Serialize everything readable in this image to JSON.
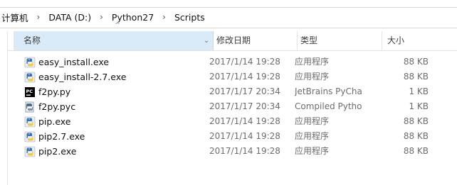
{
  "breadcrumb": [
    "计算机",
    "DATA (D:)",
    "Python27",
    "Scripts"
  ],
  "breadcrumb_separator": "›",
  "columns": {
    "name": "名称",
    "date": "修改日期",
    "type": "类型",
    "size": "大小",
    "sort_indicator": "^",
    "dropdown_indicator": "⌄"
  },
  "files": [
    {
      "name": "easy_install.exe",
      "date": "2017/1/14 19:28",
      "type": "应用程序",
      "size": "88 KB",
      "icon": "python-exe-icon"
    },
    {
      "name": "easy_install-2.7.exe",
      "date": "2017/1/14 19:28",
      "type": "应用程序",
      "size": "88 KB",
      "icon": "python-exe-icon"
    },
    {
      "name": "f2py.py",
      "date": "2017/1/17 20:34",
      "type": "JetBrains PyChar...",
      "size": "1 KB",
      "icon": "pycharm-file-icon"
    },
    {
      "name": "f2py.pyc",
      "date": "2017/1/17 20:34",
      "type": "Compiled Pytho...",
      "size": "1 KB",
      "icon": "python-compiled-icon"
    },
    {
      "name": "pip.exe",
      "date": "2017/1/14 19:28",
      "type": "应用程序",
      "size": "88 KB",
      "icon": "python-exe-icon"
    },
    {
      "name": "pip2.7.exe",
      "date": "2017/1/14 19:28",
      "type": "应用程序",
      "size": "88 KB",
      "icon": "python-exe-icon"
    },
    {
      "name": "pip2.exe",
      "date": "2017/1/14 19:28",
      "type": "应用程序",
      "size": "88 KB",
      "icon": "python-exe-icon"
    }
  ],
  "colors": {
    "header_selected": "#d9ebf9",
    "secondary_text": "#6d6d6d",
    "python_blue": "#3a6fb0",
    "python_yellow": "#f5c938"
  }
}
